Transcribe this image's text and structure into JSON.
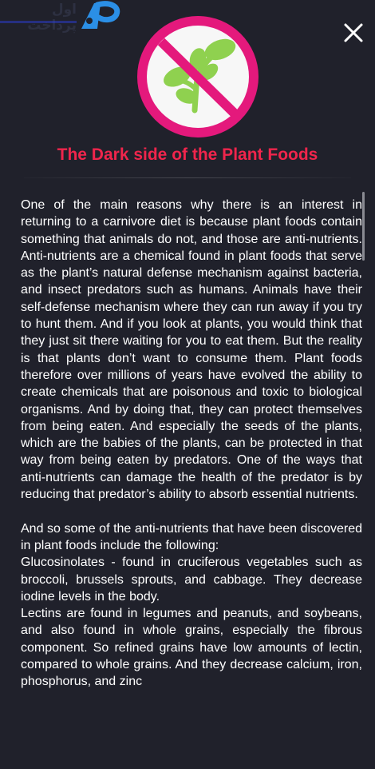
{
  "watermark": {
    "text": "اول پرداخت",
    "logo_text": "AP"
  },
  "header": {
    "close_icon": "close-icon",
    "hero_icon": "no-plants-icon",
    "title": "The Dark side of the Plant Foods"
  },
  "colors": {
    "background": "#20212b",
    "title": "#f0254c",
    "badge": "#e4197c",
    "leaf": "#8fd14f",
    "text": "#ffffff"
  },
  "article": {
    "p1": "One of the main reasons why there is an interest in returning to a carnivore diet is because plant foods contain something that animals do not, and those are anti-nutrients. Anti-nutrients are a chemical found in plant foods that serve as the plant’s natural defense mechanism against bacteria, and insect predators such as humans. Animals have their self-defense mechanism where they can run away if you try to hunt them. And if you look at plants, you would think that they just sit there waiting for you to eat them. But the reality is that plants don’t want to consume them. Plant foods therefore over millions of years have evolved the ability to create chemicals that are poisonous and toxic to biological organisms. And by doing that, they can protect themselves from being eaten. And especially the seeds of the plants, which are the babies of the plants, can be protected in that way from being eaten by predators. One of the ways that anti-nutrients can damage the health of the predator is by reducing that predator’s ability to absorb essential nutrients.",
    "p2": "And so some of the anti-nutrients that have been discovered in plant foods include the following:",
    "p3": "Glucosinolates - found in cruciferous vegetables such as broccoli, brussels sprouts, and cabbage. They decrease iodine levels in the body.",
    "p4": "Lectins are found in legumes and peanuts, and soybeans, and also found in whole grains, especially the fibrous component. So refined grains have low amounts of lectin, compared to whole grains. And they decrease calcium, iron, phosphorus, and zinc"
  }
}
